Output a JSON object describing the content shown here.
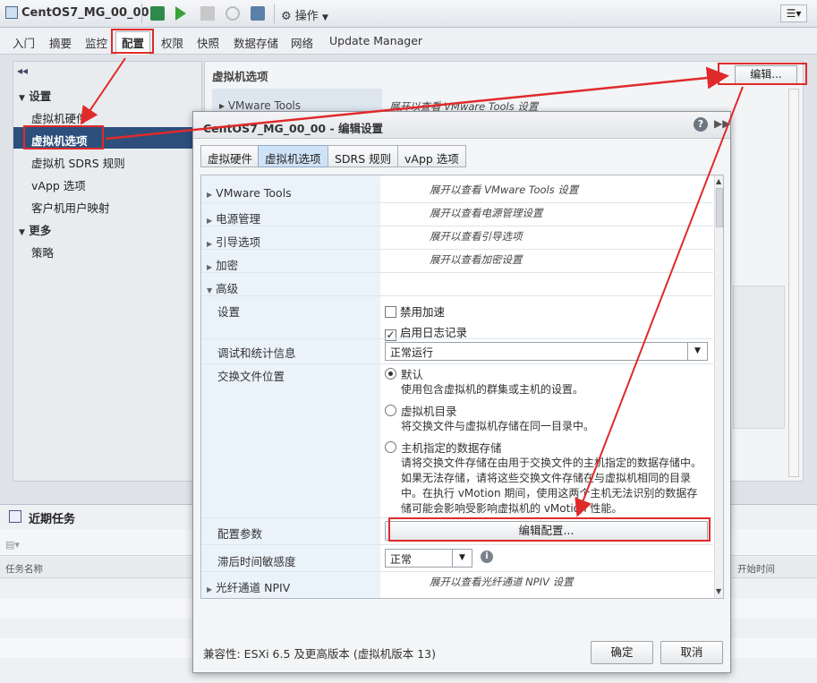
{
  "window": {
    "title": "CentOS7_MG_00_00",
    "actions_label": "操作"
  },
  "main_tabs": [
    "入门",
    "摘要",
    "监控",
    "配置",
    "权限",
    "快照",
    "数据存储",
    "网络",
    "Update Manager"
  ],
  "selected_tab": "配置",
  "nav": {
    "settings_header": "设置",
    "items": [
      "虚拟机硬件",
      "虚拟机选项",
      "虚拟机 SDRS 规则",
      "vApp 选项",
      "客户机用户映射"
    ],
    "more_header": "更多",
    "more_items": [
      "策略"
    ]
  },
  "content": {
    "title": "虚拟机选项",
    "edit_button": "编辑...",
    "bg_row_label": "VMware Tools",
    "bg_row_value": "展开以查看 VMware Tools 设置"
  },
  "recent": {
    "title": "近期任务",
    "col_task": "任务名称",
    "col_start": "开始时间"
  },
  "dialog": {
    "title": "CentOS7_MG_00_00 - 编辑设置",
    "tabs": [
      "虚拟硬件",
      "虚拟机选项",
      "SDRS 规则",
      "vApp 选项"
    ],
    "selected_tab": "虚拟机选项",
    "rows": {
      "vmware_tools": {
        "label": "VMware Tools",
        "value": "展开以查看 VMware Tools 设置"
      },
      "power": {
        "label": "电源管理",
        "value": "展开以查看电源管理设置"
      },
      "boot": {
        "label": "引导选项",
        "value": "展开以查看引导选项"
      },
      "encryption": {
        "label": "加密",
        "value": "展开以查看加密设置"
      },
      "advanced": {
        "label": "高级"
      },
      "settings": {
        "label": "设置",
        "opt1": "禁用加速",
        "opt2": "启用日志记录",
        "opt1_checked": false,
        "opt2_checked": true
      },
      "debug": {
        "label": "调试和统计信息",
        "value": "正常运行"
      },
      "swap": {
        "label": "交换文件位置",
        "r1_title": "默认",
        "r1_desc": "使用包含虚拟机的群集或主机的设置。",
        "r2_title": "虚拟机目录",
        "r2_desc": "将交换文件与虚拟机存储在同一目录中。",
        "r3_title": "主机指定的数据存储",
        "r3_desc1": "请将交换文件存储在由用于交换文件的主机指定的数据存储中。",
        "r3_desc2": "如果无法存储，请将这些交换文件存储在与虚拟机相同的目录",
        "r3_desc3": "中。在执行 vMotion 期间，使用这两个主机无法识别的数据存",
        "r3_desc4": "储可能会影响受影响虚拟机的 vMotion 性能。"
      },
      "config_params": {
        "label": "配置参数",
        "button": "编辑配置..."
      },
      "latency": {
        "label": "滞后时间敏感度",
        "value": "正常"
      },
      "npiv": {
        "label": "光纤通道 NPIV",
        "value": "展开以查看光纤通道 NPIV 设置"
      }
    },
    "compat": "兼容性: ESXi 6.5 及更高版本 (虚拟机版本 13)",
    "ok": "确定",
    "cancel": "取消"
  },
  "colors": {
    "accent_red": "#e02a2a",
    "nav_selected": "#2d4f7c",
    "tab_selected": "#cfe3f7"
  }
}
